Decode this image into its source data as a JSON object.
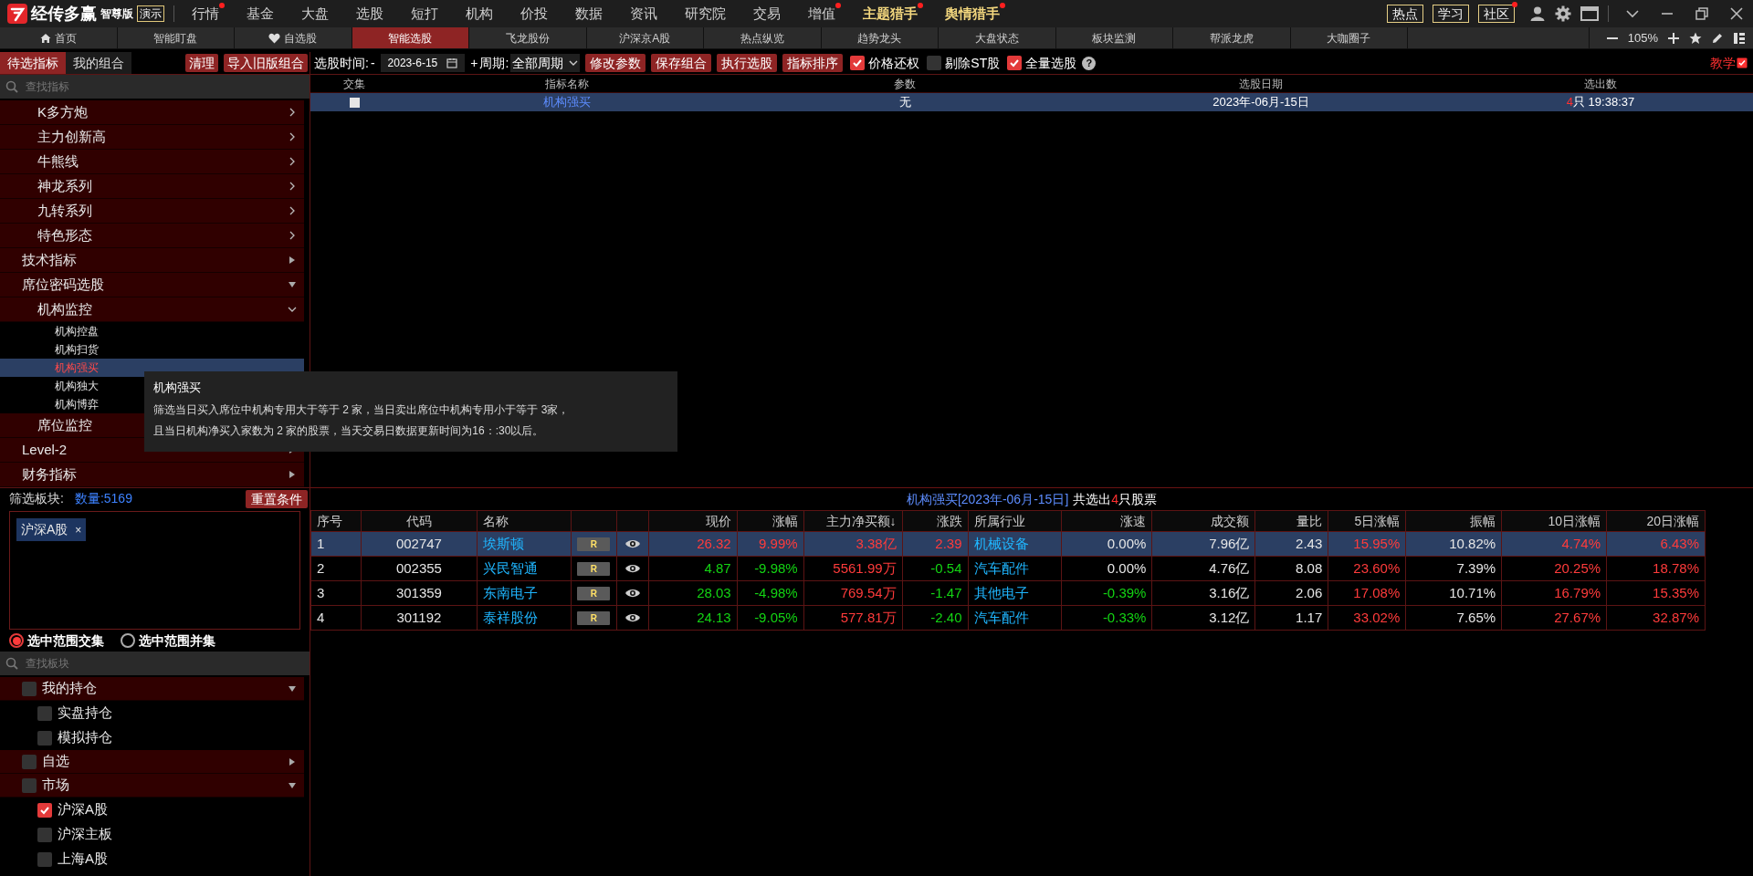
{
  "app": {
    "brand": "经传多赢",
    "edition": "智尊版",
    "mode": "演示"
  },
  "menu": [
    {
      "label": "行情",
      "dot": true,
      "accent": false
    },
    {
      "label": "基金",
      "dot": false,
      "accent": false
    },
    {
      "label": "大盘",
      "dot": false,
      "accent": false
    },
    {
      "label": "选股",
      "dot": false,
      "accent": false
    },
    {
      "label": "短打",
      "dot": false,
      "accent": false
    },
    {
      "label": "机构",
      "dot": false,
      "accent": false
    },
    {
      "label": "价投",
      "dot": false,
      "accent": false
    },
    {
      "label": "数据",
      "dot": false,
      "accent": false
    },
    {
      "label": "资讯",
      "dot": false,
      "accent": false
    },
    {
      "label": "研究院",
      "dot": false,
      "accent": false
    },
    {
      "label": "交易",
      "dot": false,
      "accent": false
    },
    {
      "label": "增值",
      "dot": true,
      "accent": false
    },
    {
      "label": "主题猎手",
      "dot": true,
      "accent": true
    },
    {
      "label": "舆情猎手",
      "dot": true,
      "accent": true
    }
  ],
  "quick_buttons": [
    {
      "label": "热点",
      "dot": false
    },
    {
      "label": "学习",
      "dot": false
    },
    {
      "label": "社区",
      "dot": true
    }
  ],
  "tabs": [
    {
      "label": "首页",
      "selected": false
    },
    {
      "label": "智能盯盘",
      "selected": false
    },
    {
      "label": "自选股",
      "selected": false
    },
    {
      "label": "智能选股",
      "selected": true
    },
    {
      "label": "飞龙股份",
      "selected": false
    },
    {
      "label": "沪深京A股",
      "selected": false
    },
    {
      "label": "热点纵览",
      "selected": false
    },
    {
      "label": "趋势龙头",
      "selected": false
    },
    {
      "label": "大盘状态",
      "selected": false
    },
    {
      "label": "板块监测",
      "selected": false
    },
    {
      "label": "帮派龙虎",
      "selected": false
    },
    {
      "label": "大咖圈子",
      "selected": false
    }
  ],
  "zoom": "105%",
  "left_tabs": [
    {
      "label": "待选指标",
      "selected": true
    },
    {
      "label": "我的组合",
      "selected": false
    }
  ],
  "left_buttons": [
    "清理",
    "导入旧版组合"
  ],
  "indicator_search": {
    "placeholder": "查找指标"
  },
  "indicator_tree": [
    {
      "children": [
        {
          "label": "K多方炮",
          "expanded": false
        },
        {
          "label": "主力创新高",
          "expanded": false
        },
        {
          "label": "牛熊线",
          "expanded": false
        },
        {
          "label": "神龙系列",
          "expanded": false
        },
        {
          "label": "九转系列",
          "expanded": false
        },
        {
          "label": "特色形态",
          "expanded": false
        }
      ]
    },
    {
      "label": "技术指标",
      "expanded": false
    },
    {
      "label": "席位密码选股",
      "expanded": true,
      "children": [
        {
          "label": "机构监控",
          "expanded": true,
          "children": [
            {
              "label": "机构控盘",
              "selected": false
            },
            {
              "label": "机构扫货",
              "selected": false
            },
            {
              "label": "机构强买",
              "selected": true
            },
            {
              "label": "机构独大",
              "selected": false
            },
            {
              "label": "机构博弈",
              "selected": false
            }
          ]
        },
        {
          "label": "席位监控"
        }
      ]
    },
    {
      "label": "Level-2",
      "expanded": false
    },
    {
      "label": "财务指标",
      "expanded": false
    }
  ],
  "tooltip": {
    "title": "机构强买",
    "lines": [
      "筛选当日买入席位中机构专用大于等于 2 家，当日卖出席位中机构专用小于等于 3家，",
      "且当日机构净买入家数为 2 家的股票，当天交易日数据更新时间为16：:30以后。"
    ]
  },
  "filter": {
    "label": "筛选板块:",
    "count": "数量:5169",
    "reset": "重置条件",
    "tags": [
      "沪深A股"
    ],
    "tag_close": "×",
    "modes": [
      {
        "label": "选中范围交集",
        "selected": true
      },
      {
        "label": "选中范围并集",
        "selected": false
      }
    ],
    "search": {
      "placeholder": "查找板块"
    },
    "boards": [
      {
        "label": "我的持仓",
        "checked": false,
        "expanded": true,
        "children": [
          {
            "label": "实盘持仓",
            "checked": false
          },
          {
            "label": "模拟持仓",
            "checked": false
          }
        ]
      },
      {
        "label": "自选",
        "checked": false,
        "expanded": false
      },
      {
        "label": "市场",
        "checked": false,
        "expanded": true,
        "children": [
          {
            "label": "沪深A股",
            "checked": true
          },
          {
            "label": "沪深主板",
            "checked": false
          },
          {
            "label": "上海A股",
            "checked": false
          }
        ]
      }
    ]
  },
  "toolbar": {
    "date_label": "选股时间:",
    "date_prefix": "-",
    "date": "2023-6-15",
    "plus": "+",
    "period_label": "周期:",
    "period": "全部周期",
    "buttons": [
      "修改参数",
      "保存组合",
      "执行选股",
      "指标排序"
    ],
    "checks": [
      {
        "label": "价格还权",
        "checked": true
      },
      {
        "label": "剔除ST股",
        "checked": false
      },
      {
        "label": "全量选股",
        "checked": true
      }
    ],
    "help": "?",
    "teach": "教学"
  },
  "strategies": {
    "columns": [
      "交集",
      "指标名称",
      "参数",
      "选股日期",
      "选出数"
    ],
    "rows": [
      {
        "checked": false,
        "selected": true,
        "name": "机构强买",
        "param": "无",
        "date": "2023年-06月-15日",
        "count": "4",
        "time": "只 19:38:37"
      }
    ]
  },
  "results": {
    "query": "机构强买[2023年-06月-15日]",
    "prefix": "共选出",
    "count": "4",
    "suffix": "只股票",
    "columns": [
      {
        "label": "序号",
        "kind": "index"
      },
      {
        "label": "代码",
        "kind": "code"
      },
      {
        "label": "名称",
        "kind": "name"
      },
      {
        "kind": "badge"
      },
      {
        "kind": "eye"
      },
      {
        "label": "现价",
        "kind": "number"
      },
      {
        "label": "涨幅",
        "kind": "number"
      },
      {
        "label": "主力净买额↓",
        "kind": "number"
      },
      {
        "label": "涨跌",
        "kind": "number"
      },
      {
        "label": "所属行业",
        "kind": "name"
      },
      {
        "label": "涨速",
        "kind": "number"
      },
      {
        "label": "成交额",
        "kind": "number"
      },
      {
        "label": "量比",
        "kind": "number"
      },
      {
        "label": "5日涨幅",
        "kind": "number"
      },
      {
        "label": "振幅",
        "kind": "number"
      },
      {
        "label": "10日涨幅",
        "kind": "number"
      },
      {
        "label": "20日涨幅",
        "kind": "number"
      }
    ],
    "rows": [
      {
        "selected": true,
        "cells": [
          {
            "text": "1"
          },
          {
            "text": "002747"
          },
          {
            "text": "埃斯顿",
            "kind": "link"
          },
          {
            "text": "R"
          },
          {
            "kind": "eye"
          },
          {
            "text": "26.32",
            "kind": "up"
          },
          {
            "text": "9.99%",
            "kind": "up"
          },
          {
            "text": "3.38亿",
            "kind": "up"
          },
          {
            "text": "2.39",
            "kind": "up"
          },
          {
            "text": "机械设备",
            "kind": "link"
          },
          {
            "text": "0.00%"
          },
          {
            "text": "7.96亿"
          },
          {
            "text": "2.43"
          },
          {
            "text": "15.95%",
            "kind": "up"
          },
          {
            "text": "10.82%"
          },
          {
            "text": "4.74%",
            "kind": "up"
          },
          {
            "text": "6.43%",
            "kind": "up"
          }
        ]
      },
      {
        "selected": false,
        "cells": [
          {
            "text": "2"
          },
          {
            "text": "002355"
          },
          {
            "text": "兴民智通",
            "kind": "link"
          },
          {
            "text": "R"
          },
          {
            "kind": "eye"
          },
          {
            "text": "4.87",
            "kind": "down"
          },
          {
            "text": "-9.98%",
            "kind": "down"
          },
          {
            "text": "5561.99万",
            "kind": "up"
          },
          {
            "text": "-0.54",
            "kind": "down"
          },
          {
            "text": "汽车配件",
            "kind": "link"
          },
          {
            "text": "0.00%"
          },
          {
            "text": "4.76亿"
          },
          {
            "text": "8.08"
          },
          {
            "text": "23.60%",
            "kind": "up"
          },
          {
            "text": "7.39%"
          },
          {
            "text": "20.25%",
            "kind": "up"
          },
          {
            "text": "18.78%",
            "kind": "up"
          }
        ]
      },
      {
        "selected": false,
        "cells": [
          {
            "text": "3"
          },
          {
            "text": "301359"
          },
          {
            "text": "东南电子",
            "kind": "link"
          },
          {
            "text": "R"
          },
          {
            "kind": "eye"
          },
          {
            "text": "28.03",
            "kind": "down"
          },
          {
            "text": "-4.98%",
            "kind": "down"
          },
          {
            "text": "769.54万",
            "kind": "up"
          },
          {
            "text": "-1.47",
            "kind": "down"
          },
          {
            "text": "其他电子",
            "kind": "link"
          },
          {
            "text": "-0.39%",
            "kind": "down"
          },
          {
            "text": "3.16亿"
          },
          {
            "text": "2.06"
          },
          {
            "text": "17.08%",
            "kind": "up"
          },
          {
            "text": "10.71%"
          },
          {
            "text": "16.79%",
            "kind": "up"
          },
          {
            "text": "15.35%",
            "kind": "up"
          }
        ]
      },
      {
        "selected": false,
        "cells": [
          {
            "text": "4"
          },
          {
            "text": "301192"
          },
          {
            "text": "泰祥股份",
            "kind": "link"
          },
          {
            "text": "R"
          },
          {
            "kind": "eye"
          },
          {
            "text": "24.13",
            "kind": "down"
          },
          {
            "text": "-9.05%",
            "kind": "down"
          },
          {
            "text": "577.81万",
            "kind": "up"
          },
          {
            "text": "-2.40",
            "kind": "down"
          },
          {
            "text": "汽车配件",
            "kind": "link"
          },
          {
            "text": "-0.33%",
            "kind": "down"
          },
          {
            "text": "3.12亿"
          },
          {
            "text": "1.17"
          },
          {
            "text": "33.02%",
            "kind": "up"
          },
          {
            "text": "7.65%"
          },
          {
            "text": "27.67%",
            "kind": "up"
          },
          {
            "text": "32.87%",
            "kind": "up"
          }
        ]
      }
    ]
  }
}
